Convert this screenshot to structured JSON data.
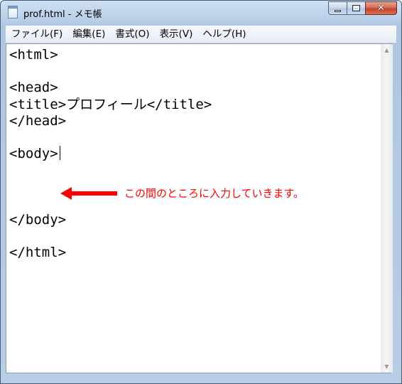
{
  "window": {
    "title": "prof.html - メモ帳",
    "controls": {
      "close_glyph": "✕"
    }
  },
  "menu": [
    {
      "label": "ファイル(F)"
    },
    {
      "label": "編集(E)"
    },
    {
      "label": "書式(O)"
    },
    {
      "label": "表示(V)"
    },
    {
      "label": "ヘルプ(H)"
    }
  ],
  "editor": {
    "lines": [
      "<html>",
      "",
      "<head>",
      "<title>プロフィール</title>",
      "</head>",
      "",
      "<body>",
      "",
      "",
      "",
      "</body>",
      "",
      "</html>"
    ],
    "caret_line_index": 6
  },
  "annotation": {
    "text": "この間のところに入力していきます。",
    "color": "#ff0000"
  },
  "scrollbar": {
    "up_glyph": "▲",
    "down_glyph": "▼"
  },
  "icons": [
    "notepad-icon",
    "minimize-icon",
    "maximize-icon",
    "close-icon",
    "arrow-left-icon",
    "scroll-up-icon",
    "scroll-down-icon"
  ]
}
